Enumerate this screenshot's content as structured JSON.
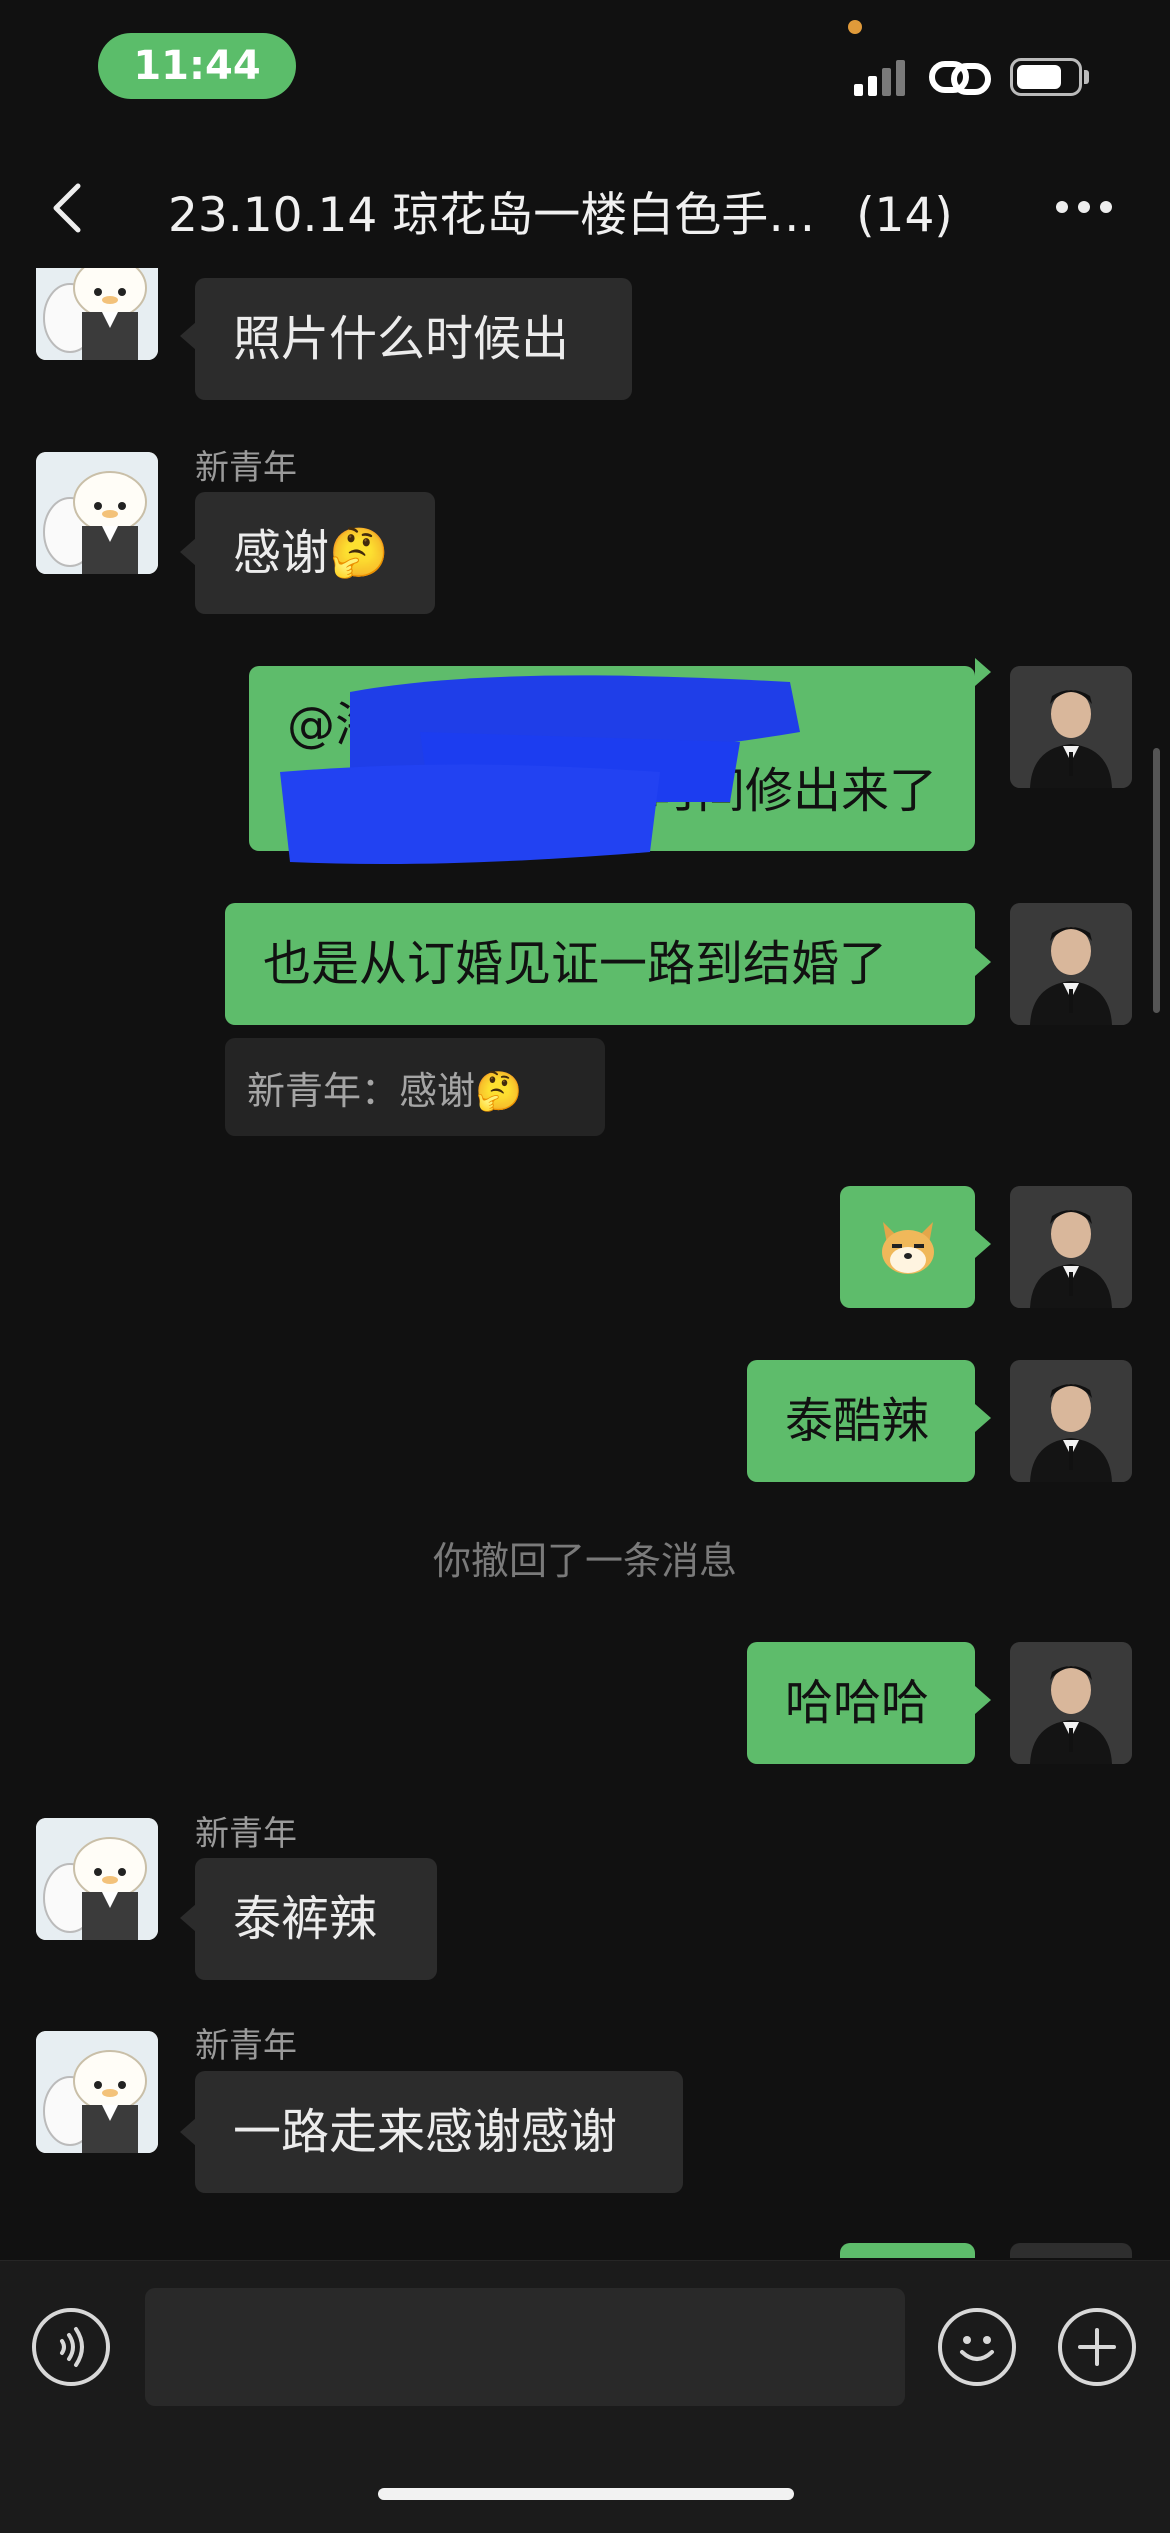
{
  "status_bar": {
    "time": "11:44",
    "battery_level": 0.75
  },
  "nav": {
    "title": "23.10.14 琼花岛一楼白色手…",
    "count": "(14)"
  },
  "messages": {
    "m1": {
      "text": "照片什么时候出"
    },
    "m2": {
      "sender": "新青年",
      "text": "感谢🤔"
    },
    "m3": {
      "line1": "@海",
      "line2": "时间修出来了",
      "redacted": true
    },
    "m4": {
      "text": "也是从订婚见证一路到结婚了",
      "quote": "新青年：感谢🤔"
    },
    "m5": {
      "sticker": "doge-emoji"
    },
    "m6": {
      "text": "泰酷辣"
    },
    "system": {
      "text": "你撤回了一条消息"
    },
    "m7": {
      "text": "哈哈哈"
    },
    "m8": {
      "sender": "新青年",
      "text": "泰裤辣"
    },
    "m9": {
      "sender": "新青年",
      "text": "一路走来感谢感谢"
    }
  },
  "icons": {
    "back": "chevron-left-icon",
    "more": "more-dots-icon",
    "voice": "voice-icon",
    "emoji": "emoji-icon",
    "plus": "plus-icon",
    "signal": "signal-icon",
    "link": "link-icon",
    "battery": "battery-icon"
  },
  "colors": {
    "outgoing_bubble": "#5ebc6b",
    "incoming_bubble": "#2c2c2c",
    "background": "#111111",
    "time_pill": "#5bbd6a"
  }
}
